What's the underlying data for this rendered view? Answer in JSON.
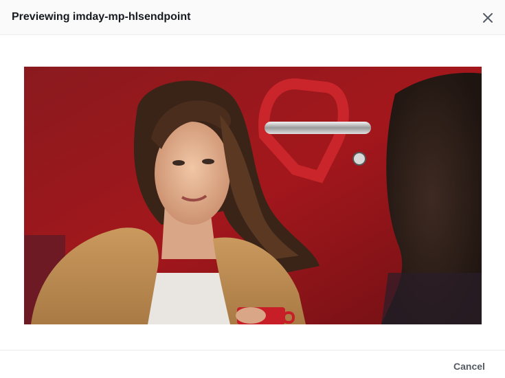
{
  "modal": {
    "title": "Previewing imday-mp-hlsendpoint",
    "close_icon": "close-icon",
    "cancel_label": "Cancel"
  },
  "video": {
    "content": "video-frame-image"
  }
}
